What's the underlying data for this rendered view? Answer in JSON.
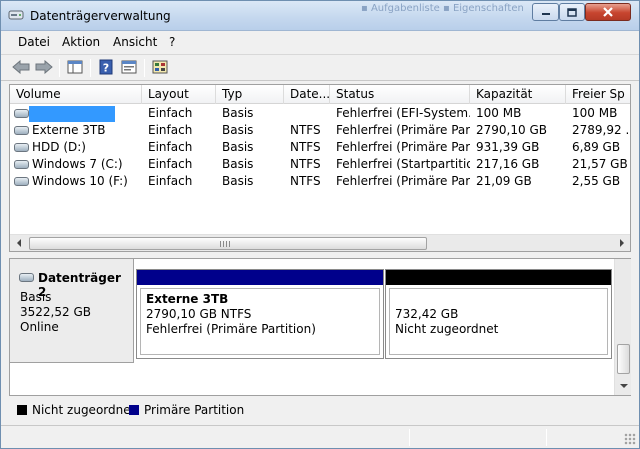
{
  "window": {
    "title": "Datenträgerverwaltung",
    "background_title": "▪ Aufgabenliste   ▪ Eigenschaften",
    "icons": {
      "app": "disk-management-icon",
      "minimize": "minimize-icon",
      "maximize": "maximize-icon",
      "close": "close-icon"
    }
  },
  "menu": {
    "items": [
      "Datei",
      "Aktion",
      "Ansicht",
      "?"
    ]
  },
  "toolbar": {
    "buttons": [
      "back-arrow-icon",
      "forward-arrow-icon",
      "console-tree-icon",
      "help-icon",
      "properties-icon",
      "disk-settings-icon"
    ]
  },
  "volume_list": {
    "columns": [
      "Volume",
      "Layout",
      "Typ",
      "Date...",
      "Status",
      "Kapazität",
      "Freier Sp"
    ],
    "rows": [
      {
        "volume": "",
        "layout": "Einfach",
        "type": "Basis",
        "fs": "",
        "status": "Fehlerfrei (EFI-System...",
        "capacity": "100 MB",
        "free": "100 MB",
        "selected": true
      },
      {
        "volume": "Externe 3TB",
        "layout": "Einfach",
        "type": "Basis",
        "fs": "NTFS",
        "status": "Fehlerfrei (Primäre Par...",
        "capacity": "2790,10 GB",
        "free": "2789,92 ..."
      },
      {
        "volume": "HDD (D:)",
        "layout": "Einfach",
        "type": "Basis",
        "fs": "NTFS",
        "status": "Fehlerfrei (Primäre Par...",
        "capacity": "931,39 GB",
        "free": "6,89 GB"
      },
      {
        "volume": "Windows 7 (C:)",
        "layout": "Einfach",
        "type": "Basis",
        "fs": "NTFS",
        "status": "Fehlerfrei (Startpartitio...",
        "capacity": "217,16 GB",
        "free": "21,57 GB"
      },
      {
        "volume": "Windows 10 (F:)",
        "layout": "Einfach",
        "type": "Basis",
        "fs": "NTFS",
        "status": "Fehlerfrei (Primäre Par...",
        "capacity": "21,09 GB",
        "free": "2,55 GB"
      }
    ]
  },
  "disk": {
    "name": "Datenträger 2",
    "type": "Basis",
    "size": "3522,52 GB",
    "state": "Online",
    "partitions": [
      {
        "name": "Externe 3TB",
        "size_fs": "2790,10 GB NTFS",
        "status": "Fehlerfrei (Primäre Partition)",
        "color": "#00008b"
      },
      {
        "name": "",
        "size_fs": "732,42 GB",
        "status": "Nicht zugeordnet",
        "color": "#000000"
      }
    ]
  },
  "legend": [
    {
      "label": "Nicht zugeordnet",
      "color": "#000000"
    },
    {
      "label": "Primäre Partition",
      "color": "#00008b"
    }
  ],
  "colors": {
    "selection": "#3399ff",
    "primary_partition": "#00008b",
    "unallocated": "#000000"
  }
}
